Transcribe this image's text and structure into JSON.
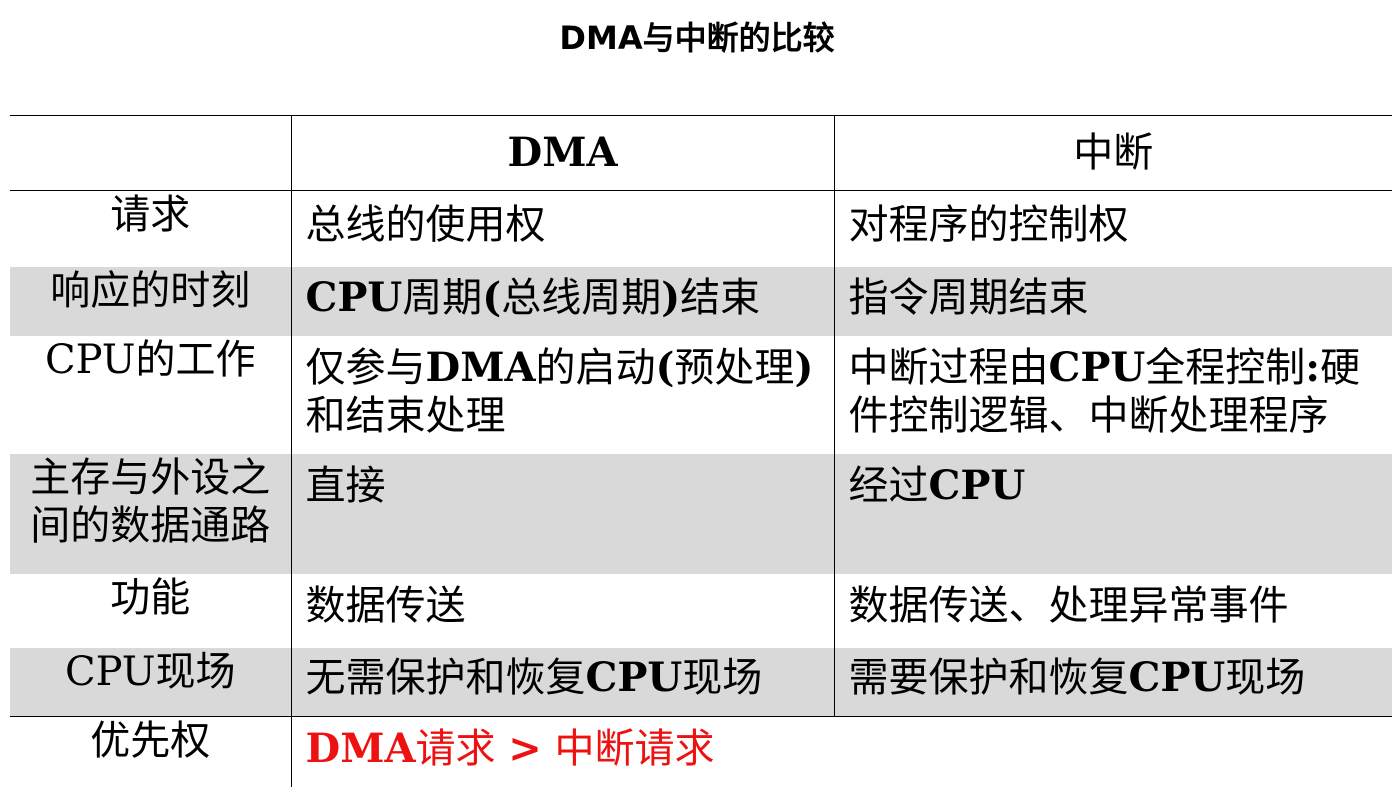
{
  "page": {
    "title": "DMA与中断的比较"
  },
  "table": {
    "headers": [
      "",
      "DMA",
      "中断"
    ],
    "rows": [
      {
        "label": "请求",
        "dma": "总线的使用权",
        "interrupt": "对程序的控制权"
      },
      {
        "label": "响应的时刻",
        "dma": "CPU周期(总线周期)结束",
        "interrupt": "指令周期结束"
      },
      {
        "label": "CPU的工作",
        "dma": "仅参与DMA的启动(预处理)和结束处理",
        "interrupt": "中断过程由CPU全程控制:硬件控制逻辑、中断处理程序"
      },
      {
        "label": "主存与外设之间的数据通路",
        "dma": "直接",
        "interrupt": "经过CPU"
      },
      {
        "label": "功能",
        "dma": "数据传送",
        "interrupt": "数据传送、处理异常事件"
      },
      {
        "label": "CPU现场",
        "dma": "无需保护和恢复CPU现场",
        "interrupt": "需要保护和恢复CPU现场"
      },
      {
        "label": "优先权",
        "priority": "DMA请求 > 中断请求"
      }
    ]
  },
  "colors": {
    "row_shade": "#d9d9d9",
    "priority_text": "#ee1111"
  }
}
